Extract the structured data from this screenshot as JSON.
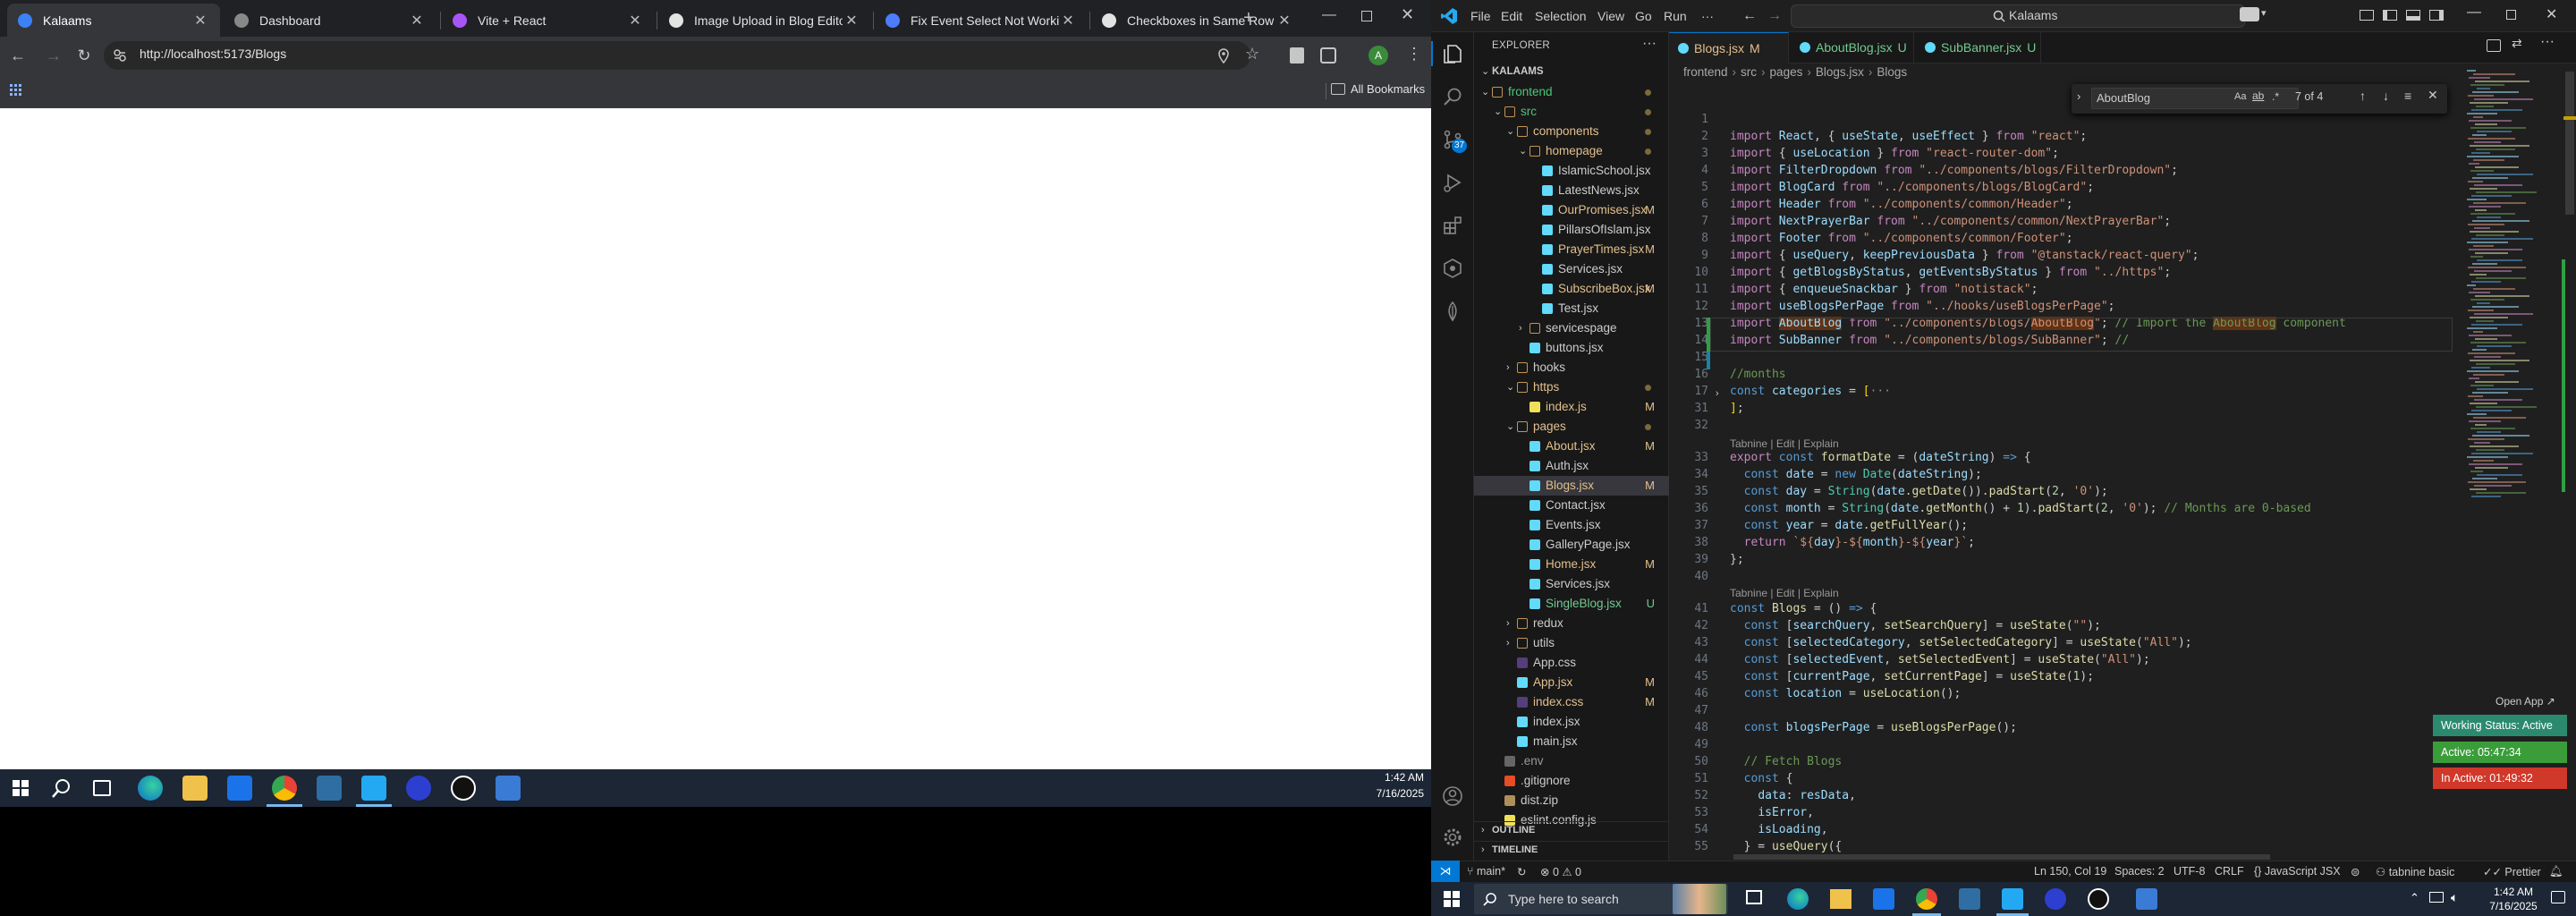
{
  "chrome": {
    "tabs": [
      {
        "title": "Kalaams",
        "active": true,
        "favicon_color": "#3b82f6"
      },
      {
        "title": "Dashboard",
        "active": false,
        "favicon_color": "#888888"
      },
      {
        "title": "Vite + React",
        "active": false,
        "favicon_color": "#a855f7"
      },
      {
        "title": "Image Upload in Blog Editor",
        "active": false,
        "favicon_color": "#e3e3e3"
      },
      {
        "title": "Fix Event Select Not Working",
        "active": false,
        "favicon_color": "#4d7cff"
      },
      {
        "title": "Checkboxes in Same Row",
        "active": false,
        "favicon_color": "#e3e3e3"
      }
    ],
    "new_tab_icon": "plus-icon",
    "url": "http://localhost:5173/Blogs",
    "all_bookmarks": "All Bookmarks",
    "profile_initial": "A"
  },
  "taskbar_left": {
    "time": "1:42 AM",
    "date": "7/16/2025"
  },
  "vscode": {
    "menu": [
      "File",
      "Edit",
      "Selection",
      "View",
      "Go",
      "Run",
      "···"
    ],
    "command_center": "Kalaams",
    "explorer_title": "EXPLORER",
    "root": "KALAAMS",
    "scm_badge": "37",
    "tree": [
      {
        "label": "frontend",
        "depth": 0,
        "type": "folder-open",
        "color": "#4ec57a",
        "status": "",
        "dot": true
      },
      {
        "label": "src",
        "depth": 1,
        "type": "folder-open",
        "color": "#4ec57a",
        "status": "",
        "dot": true
      },
      {
        "label": "components",
        "depth": 2,
        "type": "folder-open",
        "color": "#e2c08d",
        "status": "",
        "dot": true
      },
      {
        "label": "homepage",
        "depth": 3,
        "type": "folder-open",
        "color": "#e2c08d",
        "status": "",
        "dot": true
      },
      {
        "label": "IslamicSchool.jsx",
        "depth": 4,
        "type": "file",
        "color": "#cccccc",
        "status": "",
        "dot": false
      },
      {
        "label": "LatestNews.jsx",
        "depth": 4,
        "type": "file",
        "color": "#cccccc",
        "status": "",
        "dot": false
      },
      {
        "label": "OurPromises.jsx",
        "depth": 4,
        "type": "file",
        "color": "#e2c08d",
        "status": "M",
        "dot": false
      },
      {
        "label": "PillarsOfIslam.jsx",
        "depth": 4,
        "type": "file",
        "color": "#cccccc",
        "status": "",
        "dot": false
      },
      {
        "label": "PrayerTimes.jsx",
        "depth": 4,
        "type": "file",
        "color": "#e2c08d",
        "status": "M",
        "dot": false
      },
      {
        "label": "Services.jsx",
        "depth": 4,
        "type": "file",
        "color": "#cccccc",
        "status": "",
        "dot": false
      },
      {
        "label": "SubscribeBox.jsx",
        "depth": 4,
        "type": "file",
        "color": "#e2c08d",
        "status": "M",
        "dot": false
      },
      {
        "label": "Test.jsx",
        "depth": 4,
        "type": "file",
        "color": "#cccccc",
        "status": "",
        "dot": false
      },
      {
        "label": "servicespage",
        "depth": 3,
        "type": "folder",
        "color": "#cccccc",
        "status": "",
        "dot": false
      },
      {
        "label": "buttons.jsx",
        "depth": 3,
        "type": "file",
        "color": "#cccccc",
        "status": "",
        "dot": false
      },
      {
        "label": "hooks",
        "depth": 2,
        "type": "folder",
        "color": "#cccccc",
        "status": "",
        "dot": false
      },
      {
        "label": "https",
        "depth": 2,
        "type": "folder-open",
        "color": "#e2c08d",
        "status": "",
        "dot": true
      },
      {
        "label": "index.js",
        "depth": 3,
        "type": "file",
        "color": "#e2c08d",
        "status": "M",
        "dot": false
      },
      {
        "label": "pages",
        "depth": 2,
        "type": "folder-open",
        "color": "#e2c08d",
        "status": "",
        "dot": true
      },
      {
        "label": "About.jsx",
        "depth": 3,
        "type": "file",
        "color": "#e2c08d",
        "status": "M",
        "dot": false
      },
      {
        "label": "Auth.jsx",
        "depth": 3,
        "type": "file",
        "color": "#cccccc",
        "status": "",
        "dot": false
      },
      {
        "label": "Blogs.jsx",
        "depth": 3,
        "type": "file",
        "color": "#e2c08d",
        "status": "M",
        "dot": false,
        "selected": true
      },
      {
        "label": "Contact.jsx",
        "depth": 3,
        "type": "file",
        "color": "#cccccc",
        "status": "",
        "dot": false
      },
      {
        "label": "Events.jsx",
        "depth": 3,
        "type": "file",
        "color": "#cccccc",
        "status": "",
        "dot": false
      },
      {
        "label": "GalleryPage.jsx",
        "depth": 3,
        "type": "file",
        "color": "#cccccc",
        "status": "",
        "dot": false
      },
      {
        "label": "Home.jsx",
        "depth": 3,
        "type": "file",
        "color": "#e2c08d",
        "status": "M",
        "dot": false
      },
      {
        "label": "Services.jsx",
        "depth": 3,
        "type": "file",
        "color": "#cccccc",
        "status": "",
        "dot": false
      },
      {
        "label": "SingleBlog.jsx",
        "depth": 3,
        "type": "file",
        "color": "#73c991",
        "status": "U",
        "dot": false
      },
      {
        "label": "redux",
        "depth": 2,
        "type": "folder",
        "color": "#cccccc",
        "status": "",
        "dot": false
      },
      {
        "label": "utils",
        "depth": 2,
        "type": "folder",
        "color": "#cccccc",
        "status": "",
        "dot": false
      },
      {
        "label": "App.css",
        "depth": 2,
        "type": "file",
        "color": "#cccccc",
        "status": "",
        "dot": false
      },
      {
        "label": "App.jsx",
        "depth": 2,
        "type": "file",
        "color": "#e2c08d",
        "status": "M",
        "dot": false
      },
      {
        "label": "index.css",
        "depth": 2,
        "type": "file",
        "color": "#e2c08d",
        "status": "M",
        "dot": false
      },
      {
        "label": "index.jsx",
        "depth": 2,
        "type": "file",
        "color": "#cccccc",
        "status": "",
        "dot": false
      },
      {
        "label": "main.jsx",
        "depth": 2,
        "type": "file",
        "color": "#cccccc",
        "status": "",
        "dot": false
      },
      {
        "label": ".env",
        "depth": 1,
        "type": "file",
        "color": "#999999",
        "status": "",
        "dot": false
      },
      {
        "label": ".gitignore",
        "depth": 1,
        "type": "file",
        "color": "#cccccc",
        "status": "",
        "dot": false
      },
      {
        "label": "dist.zip",
        "depth": 1,
        "type": "file",
        "color": "#cccccc",
        "status": "",
        "dot": false
      },
      {
        "label": "eslint.config.js",
        "depth": 1,
        "type": "file",
        "color": "#cccccc",
        "status": "",
        "dot": false
      }
    ],
    "outline": "OUTLINE",
    "timeline": "TIMELINE",
    "editor_tabs": [
      {
        "label": "Blogs.jsx",
        "status": "M",
        "active": true
      },
      {
        "label": "AboutBlog.jsx",
        "status": "U",
        "active": false
      },
      {
        "label": "SubBanner.jsx",
        "status": "U",
        "active": false
      }
    ],
    "breadcrumb": [
      "frontend",
      "src",
      "pages",
      "Blogs.jsx",
      "Blogs"
    ],
    "find": {
      "query": "AboutBlog",
      "result": "7 of 4"
    },
    "codelens": "Tabnine | Edit | Explain",
    "code": [
      {
        "n": "1",
        "h": ""
      },
      {
        "n": "2",
        "h": "<span class='kw'>import</span> <span class='v'>React</span>, { <span class='v'>useState</span>, <span class='v'>useEffect</span> } <span class='kw'>from</span> <span class='s'>\"react\"</span>;"
      },
      {
        "n": "3",
        "h": "<span class='kw'>import</span> { <span class='v'>useLocation</span> } <span class='kw'>from</span> <span class='s'>\"react-router-dom\"</span>;"
      },
      {
        "n": "4",
        "h": "<span class='kw'>import</span> <span class='v'>FilterDropdown</span> <span class='kw'>from</span> <span class='s'>\"../components/blogs/FilterDropdown\"</span>;"
      },
      {
        "n": "5",
        "h": "<span class='kw'>import</span> <span class='v'>BlogCard</span> <span class='kw'>from</span> <span class='s'>\"../components/blogs/BlogCard\"</span>;"
      },
      {
        "n": "6",
        "h": "<span class='kw'>import</span> <span class='v'>Header</span> <span class='kw'>from</span> <span class='s'>\"../components/common/Header\"</span>;"
      },
      {
        "n": "7",
        "h": "<span class='kw'>import</span> <span class='v'>NextPrayerBar</span> <span class='kw'>from</span> <span class='s'>\"../components/common/NextPrayerBar\"</span>;"
      },
      {
        "n": "8",
        "h": "<span class='kw'>import</span> <span class='v'>Footer</span> <span class='kw'>from</span> <span class='s'>\"../components/common/Footer\"</span>;"
      },
      {
        "n": "9",
        "h": "<span class='kw'>import</span> { <span class='v'>useQuery</span>, <span class='v'>keepPreviousData</span> } <span class='kw'>from</span> <span class='s'>\"@tanstack/react-query\"</span>;"
      },
      {
        "n": "10",
        "h": "<span class='kw'>import</span> { <span class='v'>getBlogsByStatus</span>, <span class='v'>getEventsByStatus</span> } <span class='kw'>from</span> <span class='s'>\"../https\"</span>;"
      },
      {
        "n": "11",
        "h": "<span class='kw'>import</span> { <span class='v'>enqueueSnackbar</span> } <span class='kw'>from</span> <span class='s'>\"notistack\"</span>;"
      },
      {
        "n": "12",
        "h": "<span class='kw'>import</span> <span class='v'>useBlogsPerPage</span> <span class='kw'>from</span> <span class='s'>\"../hooks/useBlogsPerPage\"</span>;"
      },
      {
        "n": "13",
        "h": "<span class='kw'>import</span> <span class='v hl'>AboutBlog</span> <span class='kw'>from</span> <span class='s'>\"../components/blogs/<span class='hl'>AboutBlog</span>\"</span>; <span class='c'>// Import the <span class='hl'>AboutBlog</span> component</span>"
      },
      {
        "n": "14",
        "h": "<span class='kw'>import</span> <span class='v'>SubBanner</span> <span class='kw'>from</span> <span class='s'>\"../components/blogs/SubBanner\"</span>; <span class='c'>//</span>"
      },
      {
        "n": "15",
        "h": ""
      },
      {
        "n": "16",
        "h": "<span class='c'>//months</span>"
      },
      {
        "n": "17",
        "h": "<span class='ky'>const</span> <span class='v'>categories</span> = <span class='p'>[</span><span style='color:#888'>···</span>"
      },
      {
        "n": "31",
        "h": "<span class='p'>]</span>;"
      },
      {
        "n": "32",
        "h": ""
      },
      {
        "n": "33",
        "h": "<span class='kw'>export</span> <span class='ky'>const</span> <span class='f'>formatDate</span> = (<span class='v'>dateString</span>) <span class='ky'>=&gt;</span> {"
      },
      {
        "n": "34",
        "h": "  <span class='ky'>const</span> <span class='v'>date</span> = <span class='ky'>new</span> <span class='t'>Date</span>(<span class='v'>dateString</span>);"
      },
      {
        "n": "35",
        "h": "  <span class='ky'>const</span> <span class='v'>day</span> = <span class='t'>String</span>(<span class='v'>date</span>.<span class='f'>getDate</span>()).<span class='f'>padStart</span>(<span class='n'>2</span>, <span class='s'>'0'</span>);"
      },
      {
        "n": "36",
        "h": "  <span class='ky'>const</span> <span class='v'>month</span> = <span class='t'>String</span>(<span class='v'>date</span>.<span class='f'>getMonth</span>() + <span class='n'>1</span>).<span class='f'>padStart</span>(<span class='n'>2</span>, <span class='s'>'0'</span>); <span class='c'>// Months are 0-based</span>"
      },
      {
        "n": "37",
        "h": "  <span class='ky'>const</span> <span class='v'>year</span> = <span class='v'>date</span>.<span class='f'>getFullYear</span>();"
      },
      {
        "n": "38",
        "h": "  <span class='kw'>return</span> <span class='s'>`${</span><span class='v'>day</span><span class='s'>}-${</span><span class='v'>month</span><span class='s'>}-${</span><span class='v'>year</span><span class='s'>}`</span>;"
      },
      {
        "n": "39",
        "h": "};"
      },
      {
        "n": "40",
        "h": ""
      },
      {
        "n": "41",
        "h": "<span class='ky'>const</span> <span class='f'>Blogs</span> = () <span class='ky'>=&gt;</span> {"
      },
      {
        "n": "42",
        "h": "  <span class='ky'>const</span> [<span class='v'>searchQuery</span>, <span class='f'>setSearchQuery</span>] = <span class='f'>useState</span>(<span class='s'>\"\"</span>);"
      },
      {
        "n": "43",
        "h": "  <span class='ky'>const</span> [<span class='v'>selectedCategory</span>, <span class='f'>setSelectedCategory</span>] = <span class='f'>useState</span>(<span class='s'>\"All\"</span>);"
      },
      {
        "n": "44",
        "h": "  <span class='ky'>const</span> [<span class='v'>selectedEvent</span>, <span class='f'>setSelectedEvent</span>] = <span class='f'>useState</span>(<span class='s'>\"All\"</span>);"
      },
      {
        "n": "45",
        "h": "  <span class='ky'>const</span> [<span class='v'>currentPage</span>, <span class='f'>setCurrentPage</span>] = <span class='f'>useState</span>(<span class='n'>1</span>);"
      },
      {
        "n": "46",
        "h": "  <span class='ky'>const</span> <span class='v'>location</span> = <span class='f'>useLocation</span>();"
      },
      {
        "n": "47",
        "h": ""
      },
      {
        "n": "48",
        "h": "  <span class='ky'>const</span> <span class='v'>blogsPerPage</span> = <span class='f'>useBlogsPerPage</span>();"
      },
      {
        "n": "49",
        "h": ""
      },
      {
        "n": "50",
        "h": "  <span class='c'>// Fetch Blogs</span>"
      },
      {
        "n": "51",
        "h": "  <span class='ky'>const</span> {"
      },
      {
        "n": "52",
        "h": "    <span class='v'>data</span>: <span class='v'>resData</span>,"
      },
      {
        "n": "53",
        "h": "    <span class='v'>isError</span>,"
      },
      {
        "n": "54",
        "h": "    <span class='v'>isLoading</span>,"
      },
      {
        "n": "55",
        "h": "  } = <span class='f'>useQuery</span>({"
      }
    ],
    "open_app": "Open App",
    "working_status": "Working Status: Active",
    "active_time": "Active: 05:47:34",
    "inactive_time": "In Active: 01:49:32",
    "status": {
      "branch": "main*",
      "problems": "0 ⚠ 0",
      "position": "Ln 150, Col 19",
      "spaces": "Spaces: 2",
      "encoding": "UTF-8",
      "eol": "CRLF",
      "language": "JavaScript JSX",
      "tabnine": "tabnine basic",
      "prettier": "Prettier"
    }
  },
  "taskbar_right": {
    "search_placeholder": "Type here to search",
    "time": "1:42 AM",
    "date": "7/16/2025"
  }
}
